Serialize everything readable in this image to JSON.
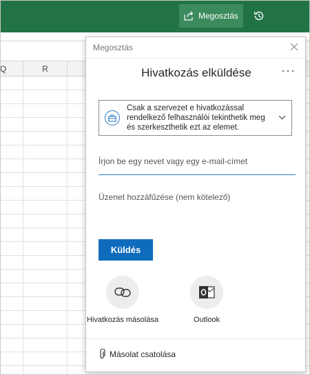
{
  "ribbon": {
    "share_label": "Megosztás",
    "accent_color": "#217346"
  },
  "sheet": {
    "columns": [
      "Q",
      "R"
    ]
  },
  "share_panel": {
    "caption": "Megosztás",
    "title": "Hivatkozás elküldése",
    "more_label": "···",
    "permission_text": "Csak a szervezet e hivatkozással rendelkező felhasználói tekinthetik meg és szerkeszthetik ezt az elemet.",
    "name_placeholder": "Írjon be egy nevet vagy egy e-mail-címet",
    "message_placeholder": "Üzenet hozzáfűzése (nem kötelező)",
    "send_label": "Küldés",
    "options": [
      {
        "label": "Hivatkozás másolása",
        "icon": "link-icon"
      },
      {
        "label": "Outlook",
        "icon": "outlook-icon"
      }
    ],
    "attach_label": "Másolat csatolása",
    "primary_color": "#0f6cbd"
  }
}
